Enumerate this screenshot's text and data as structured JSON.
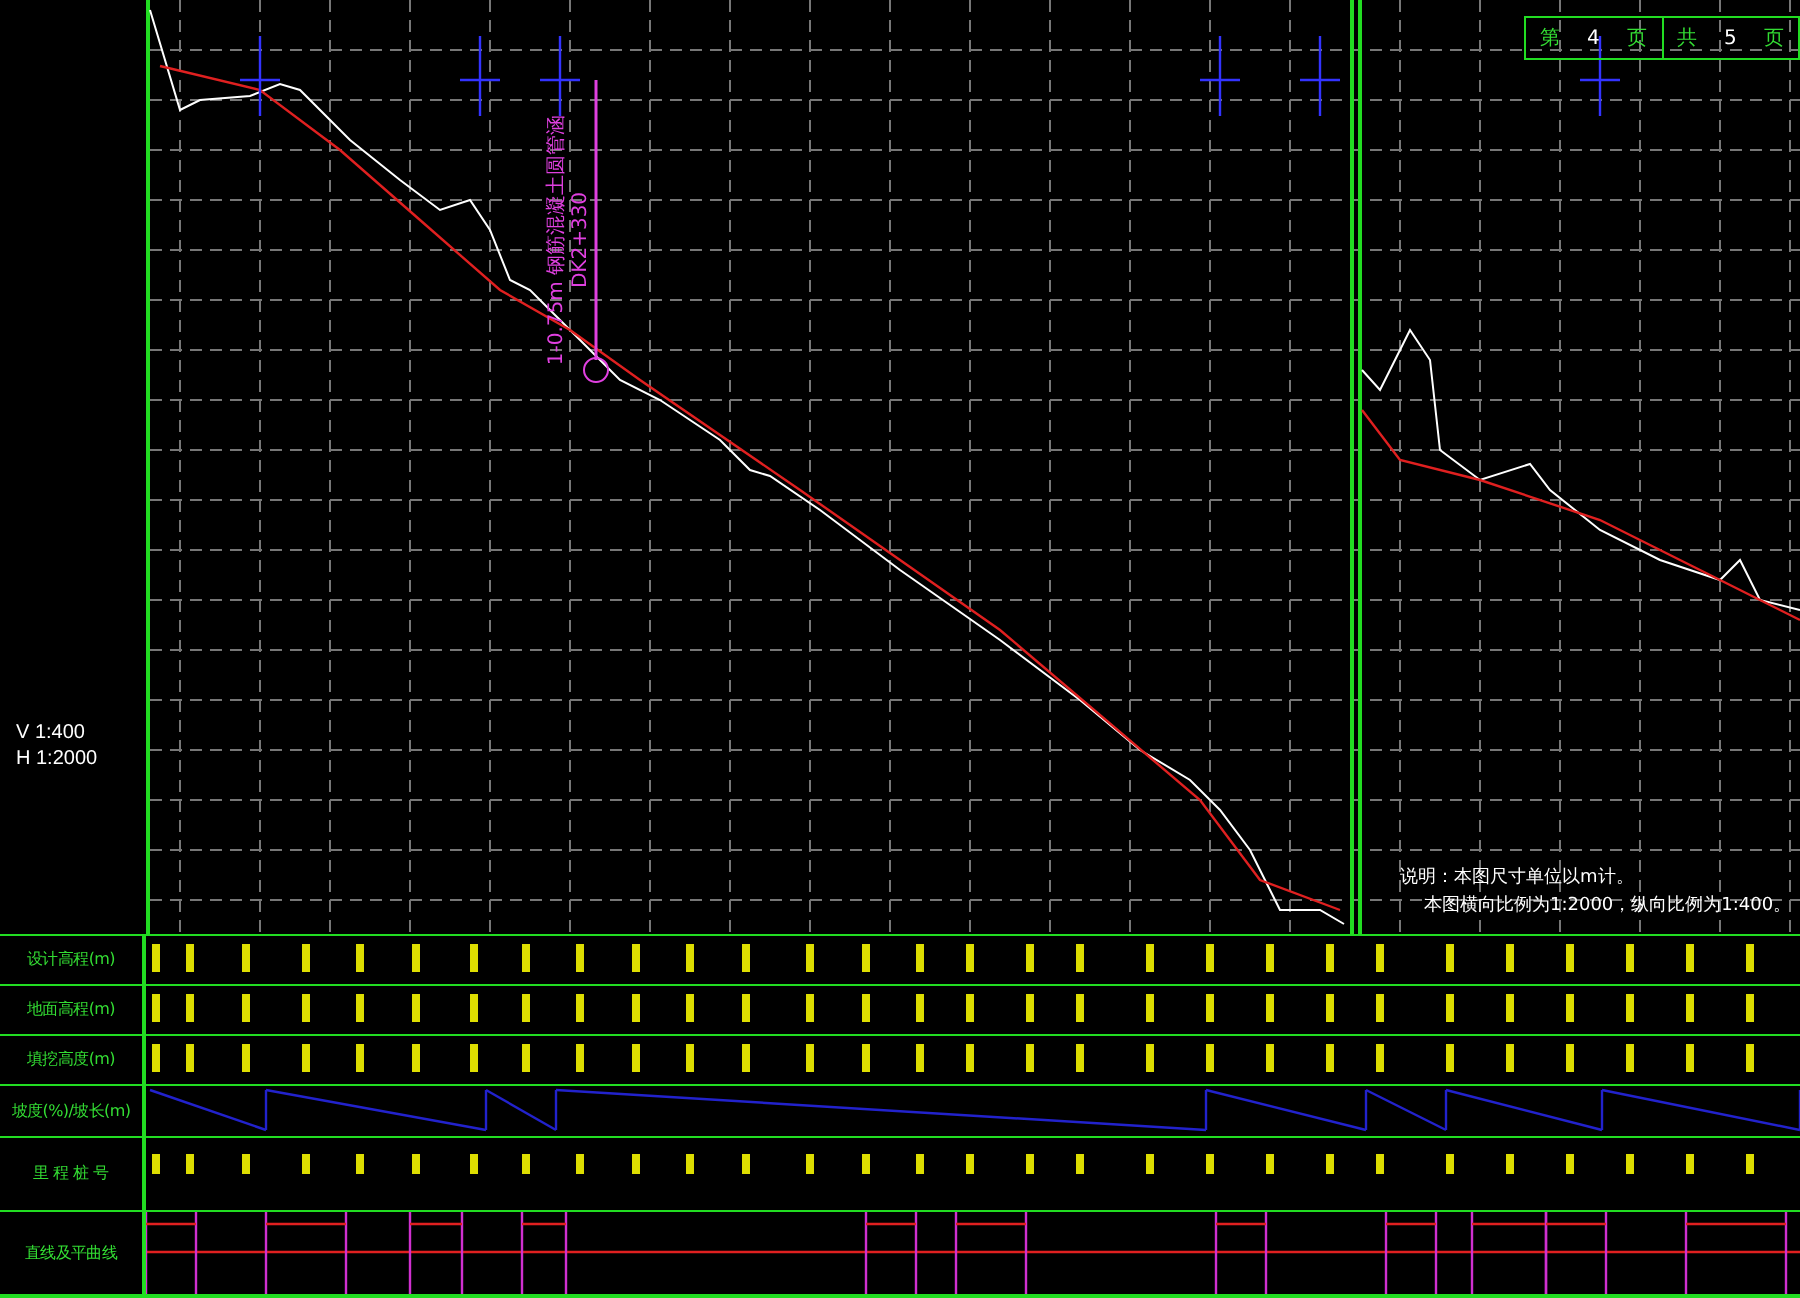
{
  "drawing": {
    "scale": {
      "vertical": "V 1:400",
      "horizontal": "H 1:2000"
    },
    "culvert_note": {
      "structure": "1-0.75m 钢筋混凝土圆管涵",
      "station": "DK2+330"
    },
    "page": {
      "current_prefix": "第",
      "current": "4",
      "current_suffix": "页",
      "total_prefix": "共",
      "total": "5",
      "total_suffix": "页"
    },
    "notes": [
      "说明：本图尺寸单位以m计。",
      "本图横向比例为1:2000，纵向比例为1:400。"
    ]
  },
  "table": {
    "rows": [
      {
        "label": "设计高程(m)",
        "kind": "values"
      },
      {
        "label": "地面高程(m)",
        "kind": "values"
      },
      {
        "label": "填挖高度(m)",
        "kind": "values"
      },
      {
        "label": "坡度(%)/坡长(m)",
        "kind": "slope"
      },
      {
        "label": "里 程 桩 号",
        "kind": "stations"
      },
      {
        "label": "直线及平曲线",
        "kind": "alignment"
      }
    ]
  }
}
